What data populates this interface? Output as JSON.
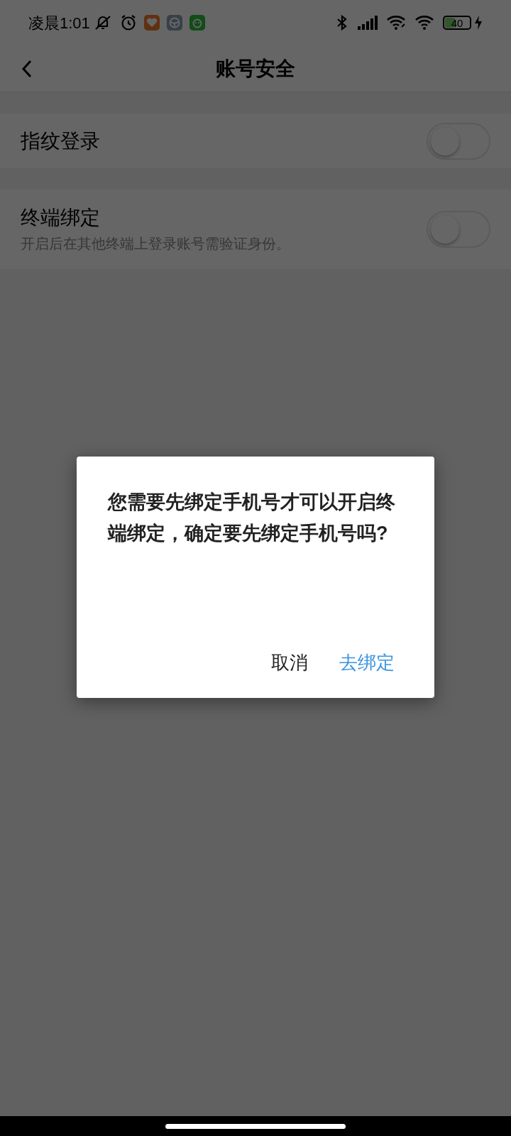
{
  "status_bar": {
    "time": "凌晨1:01",
    "battery": "40"
  },
  "header": {
    "title": "账号安全"
  },
  "settings": [
    {
      "label": "指纹登录",
      "on": false
    },
    {
      "label": "终端绑定",
      "description": "开启后在其他终端上登录账号需验证身份。",
      "on": false
    }
  ],
  "dialog": {
    "message": "您需要先绑定手机号才可以开启终端绑定，确定要先绑定手机号吗?",
    "buttons": [
      {
        "label": "取消",
        "kind": "cancel"
      },
      {
        "label": "去绑定",
        "kind": "confirm"
      }
    ]
  }
}
